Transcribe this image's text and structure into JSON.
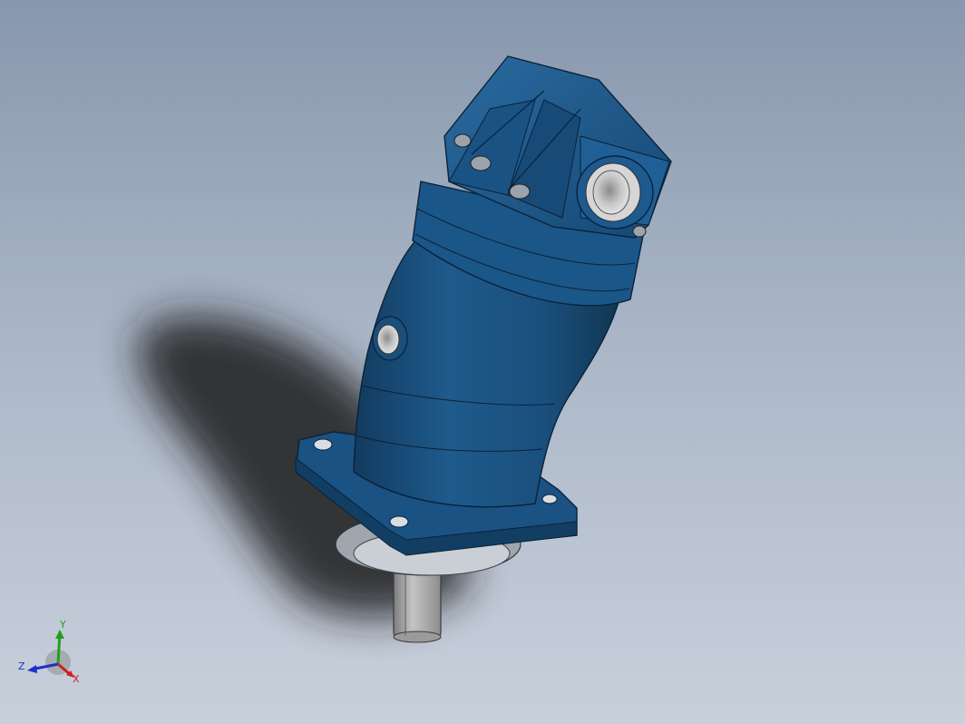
{
  "viewport": {
    "background_top": "#8797ad",
    "background_bottom": "#c9d0dc"
  },
  "model": {
    "body_color": "#1d5686",
    "body_highlight": "#2a6aa0",
    "body_shadow": "#133d61",
    "port_color": "#b9b9b9",
    "shaft_color": "#a6a6a6",
    "shadow_color": "#1a1a1a"
  },
  "triad": {
    "x_label": "X",
    "y_label": "Y",
    "z_label": "Z",
    "x_color": "#d21d1d",
    "y_color": "#1ea01e",
    "z_color": "#1c2fc8"
  }
}
